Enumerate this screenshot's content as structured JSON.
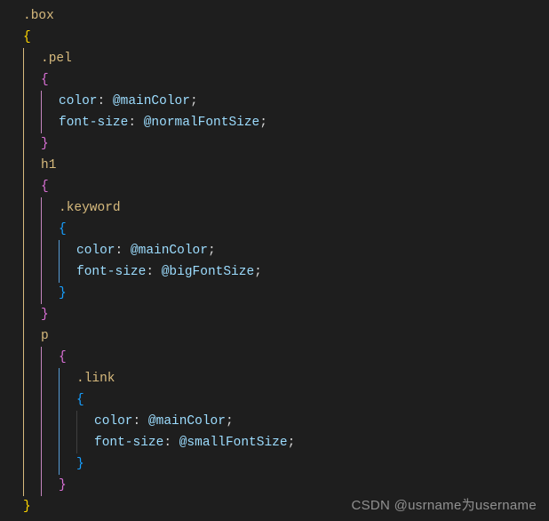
{
  "watermark": "CSDN @usrname为username",
  "colors": {
    "selector": "#d7ba7d",
    "brace_yellow": "#ffd700",
    "brace_pink": "#da70d6",
    "brace_blue": "#179fff",
    "property": "#9cdcfe",
    "variable": "#9cdcfe",
    "guide_yellow": "#d7ba7d",
    "guide_pink": "#c586c0",
    "guide_blue": "#569cd6",
    "guide_dim": "#404040",
    "background": "#1e1e1e"
  },
  "lines": [
    {
      "indent": 0,
      "guides": [],
      "tokens": [
        {
          "t": ".box",
          "c": "sel"
        }
      ]
    },
    {
      "indent": 0,
      "guides": [],
      "tokens": [
        {
          "t": "{",
          "c": "brace-y"
        }
      ]
    },
    {
      "indent": 1,
      "guides": [
        "g0"
      ],
      "tokens": [
        {
          "t": ".pel",
          "c": "sel"
        }
      ]
    },
    {
      "indent": 1,
      "guides": [
        "g0"
      ],
      "tokens": [
        {
          "t": "{",
          "c": "brace-p"
        }
      ]
    },
    {
      "indent": 2,
      "guides": [
        "g0",
        "g1"
      ],
      "tokens": [
        {
          "t": "color",
          "c": "prop"
        },
        {
          "t": ": ",
          "c": "punc"
        },
        {
          "t": "@mainColor",
          "c": "var"
        },
        {
          "t": ";",
          "c": "punc"
        }
      ]
    },
    {
      "indent": 2,
      "guides": [
        "g0",
        "g1"
      ],
      "tokens": [
        {
          "t": "font-size",
          "c": "prop"
        },
        {
          "t": ": ",
          "c": "punc"
        },
        {
          "t": "@normalFontSize",
          "c": "var"
        },
        {
          "t": ";",
          "c": "punc"
        }
      ]
    },
    {
      "indent": 1,
      "guides": [
        "g0"
      ],
      "tokens": [
        {
          "t": "}",
          "c": "brace-p"
        }
      ]
    },
    {
      "indent": 1,
      "guides": [
        "g0"
      ],
      "tokens": [
        {
          "t": "h1",
          "c": "tag"
        }
      ]
    },
    {
      "indent": 1,
      "guides": [
        "g0"
      ],
      "tokens": [
        {
          "t": "{",
          "c": "brace-p"
        }
      ]
    },
    {
      "indent": 2,
      "guides": [
        "g0",
        "g1"
      ],
      "tokens": [
        {
          "t": ".keyword",
          "c": "sel"
        }
      ]
    },
    {
      "indent": 2,
      "guides": [
        "g0",
        "g1"
      ],
      "tokens": [
        {
          "t": "{",
          "c": "brace-b"
        }
      ]
    },
    {
      "indent": 3,
      "guides": [
        "g0",
        "g1",
        "g2"
      ],
      "tokens": [
        {
          "t": "color",
          "c": "prop"
        },
        {
          "t": ": ",
          "c": "punc"
        },
        {
          "t": "@mainColor",
          "c": "var"
        },
        {
          "t": ";",
          "c": "punc"
        }
      ]
    },
    {
      "indent": 3,
      "guides": [
        "g0",
        "g1",
        "g2"
      ],
      "tokens": [
        {
          "t": "font-size",
          "c": "prop"
        },
        {
          "t": ": ",
          "c": "punc"
        },
        {
          "t": "@bigFontSize",
          "c": "var"
        },
        {
          "t": ";",
          "c": "punc"
        }
      ]
    },
    {
      "indent": 2,
      "guides": [
        "g0",
        "g1"
      ],
      "tokens": [
        {
          "t": "}",
          "c": "brace-b"
        }
      ]
    },
    {
      "indent": 1,
      "guides": [
        "g0"
      ],
      "tokens": [
        {
          "t": "}",
          "c": "brace-p"
        }
      ]
    },
    {
      "indent": 1,
      "guides": [
        "g0"
      ],
      "tokens": [
        {
          "t": "p",
          "c": "tag"
        }
      ]
    },
    {
      "indent": 2,
      "guides": [
        "g0",
        "g1"
      ],
      "tokens": [
        {
          "t": "{",
          "c": "brace-p"
        }
      ]
    },
    {
      "indent": 3,
      "guides": [
        "g0",
        "g1",
        "g2"
      ],
      "tokens": [
        {
          "t": ".link",
          "c": "sel"
        }
      ]
    },
    {
      "indent": 3,
      "guides": [
        "g0",
        "g1",
        "g2"
      ],
      "tokens": [
        {
          "t": "{",
          "c": "brace-b"
        }
      ]
    },
    {
      "indent": 4,
      "guides": [
        "g0",
        "g1",
        "g2",
        "g3"
      ],
      "tokens": [
        {
          "t": "color",
          "c": "prop"
        },
        {
          "t": ": ",
          "c": "punc"
        },
        {
          "t": "@mainColor",
          "c": "var"
        },
        {
          "t": ";",
          "c": "punc"
        }
      ]
    },
    {
      "indent": 4,
      "guides": [
        "g0",
        "g1",
        "g2",
        "g3"
      ],
      "tokens": [
        {
          "t": "font-size",
          "c": "prop"
        },
        {
          "t": ": ",
          "c": "punc"
        },
        {
          "t": "@smallFontSize",
          "c": "var"
        },
        {
          "t": ";",
          "c": "punc"
        }
      ]
    },
    {
      "indent": 3,
      "guides": [
        "g0",
        "g1",
        "g2"
      ],
      "tokens": [
        {
          "t": "}",
          "c": "brace-b"
        }
      ]
    },
    {
      "indent": 2,
      "guides": [
        "g0",
        "g1"
      ],
      "tokens": [
        {
          "t": "}",
          "c": "brace-p"
        }
      ]
    },
    {
      "indent": 0,
      "guides": [],
      "tokens": [
        {
          "t": "}",
          "c": "brace-y"
        }
      ]
    }
  ]
}
